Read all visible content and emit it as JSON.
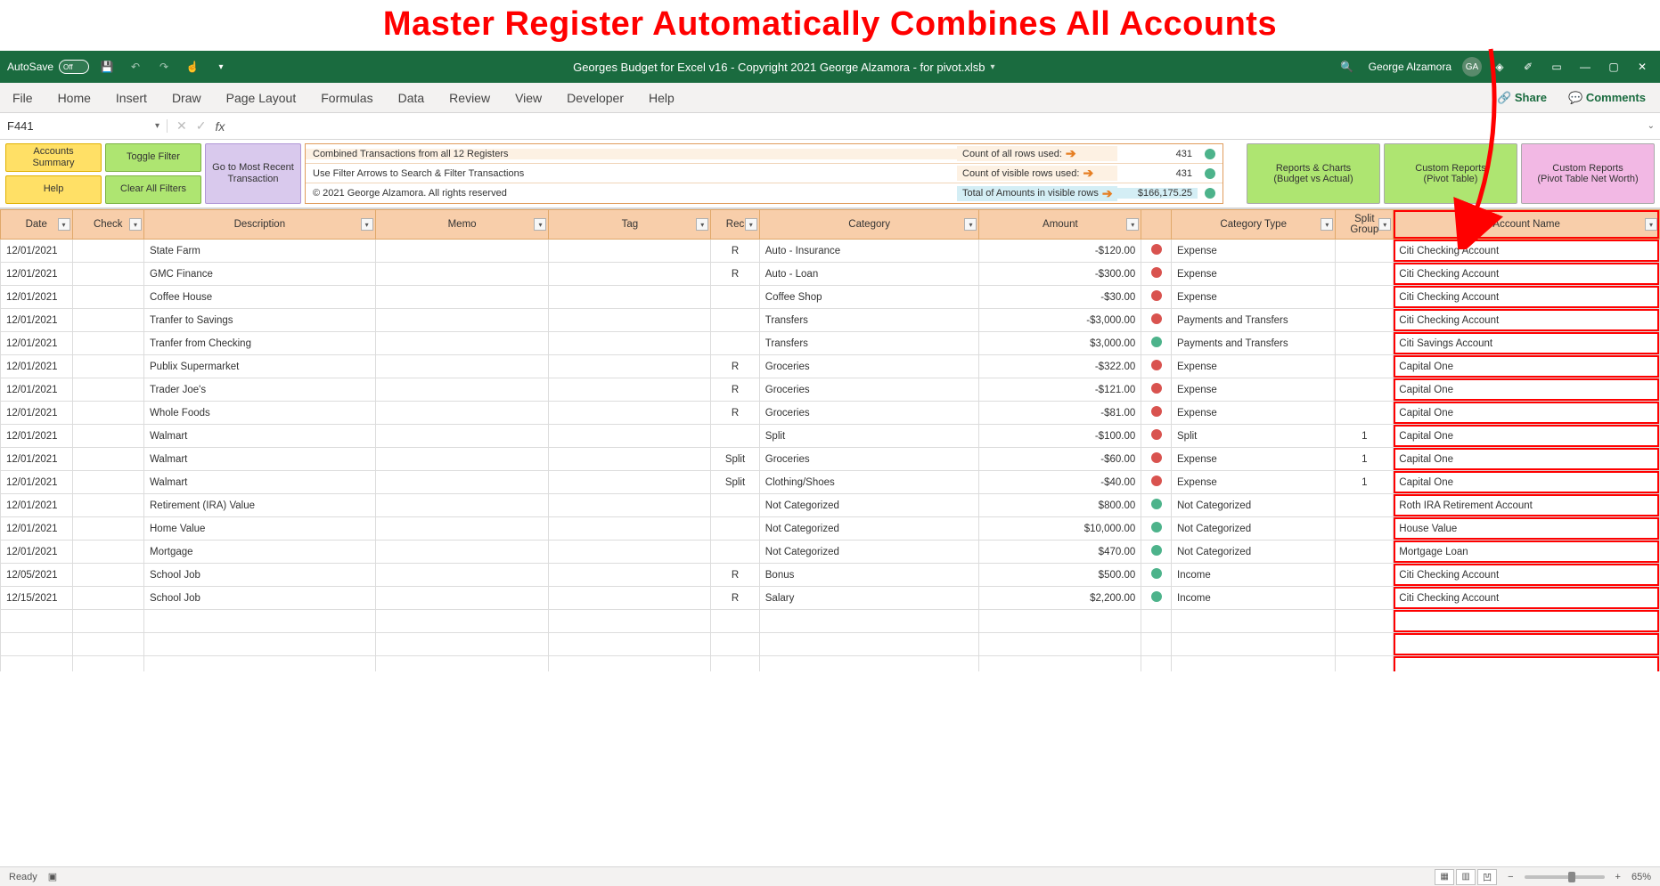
{
  "annotation_title": "Master Register Automatically Combines All Accounts",
  "titlebar": {
    "autosave_label": "AutoSave",
    "autosave_state": "Off",
    "doc_title": "Georges Budget for Excel v16 - Copyright 2021 George Alzamora - for pivot.xlsb",
    "user_name": "George Alzamora",
    "user_initials": "GA"
  },
  "ribbon_tabs": [
    "File",
    "Home",
    "Insert",
    "Draw",
    "Page Layout",
    "Formulas",
    "Data",
    "Review",
    "View",
    "Developer",
    "Help"
  ],
  "ribbon_right": {
    "share": "Share",
    "comments": "Comments"
  },
  "namebox": "F441",
  "formula": "",
  "controls": {
    "accounts_summary": "Accounts Summary",
    "help": "Help",
    "toggle_filter": "Toggle Filter",
    "clear_filters": "Clear All Filters",
    "goto_recent": "Go to Most Recent Transaction",
    "info_rows": [
      {
        "left": "Combined Transactions from all 12 Registers",
        "key": "Count of all rows used:",
        "val": "431"
      },
      {
        "left": "Use Filter Arrows to Search & Filter Transactions",
        "key": "Count of visible rows used:",
        "val": "431"
      },
      {
        "left": "© 2021 George Alzamora. All rights reserved",
        "key": "Total of Amounts in visible rows",
        "val": "$166,175.25"
      }
    ],
    "reports_charts": "Reports & Charts\n(Budget vs Actual)",
    "custom_reports_pivot": "Custom Reports\n(Pivot Table)",
    "custom_reports_networth": "Custom Reports\n(Pivot Table Net Worth)"
  },
  "columns": [
    "Date",
    "Check",
    "Description",
    "Memo",
    "Tag",
    "Rec",
    "Category",
    "Amount",
    "",
    "Category Type",
    "Split Group",
    "Account Name"
  ],
  "rows": [
    {
      "date": "12/01/2021",
      "check": "",
      "desc": "State Farm",
      "memo": "",
      "tag": "",
      "rec": "R",
      "cat": "Auto - Insurance",
      "amt": "-$120.00",
      "dot": "red",
      "ctype": "Expense",
      "split": "",
      "acct": "Citi Checking Account"
    },
    {
      "date": "12/01/2021",
      "check": "",
      "desc": "GMC Finance",
      "memo": "",
      "tag": "",
      "rec": "R",
      "cat": "Auto - Loan",
      "amt": "-$300.00",
      "dot": "red",
      "ctype": "Expense",
      "split": "",
      "acct": "Citi Checking Account"
    },
    {
      "date": "12/01/2021",
      "check": "",
      "desc": "Coffee House",
      "memo": "",
      "tag": "",
      "rec": "",
      "cat": "Coffee Shop",
      "amt": "-$30.00",
      "dot": "red",
      "ctype": "Expense",
      "split": "",
      "acct": "Citi Checking Account"
    },
    {
      "date": "12/01/2021",
      "check": "",
      "desc": "Tranfer to Savings",
      "memo": "",
      "tag": "",
      "rec": "",
      "cat": "Transfers",
      "amt": "-$3,000.00",
      "dot": "red",
      "ctype": "Payments and Transfers",
      "split": "",
      "acct": "Citi Checking Account"
    },
    {
      "date": "12/01/2021",
      "check": "",
      "desc": "Tranfer from Checking",
      "memo": "",
      "tag": "",
      "rec": "",
      "cat": "Transfers",
      "amt": "$3,000.00",
      "dot": "green",
      "ctype": "Payments and Transfers",
      "split": "",
      "acct": "Citi Savings Account"
    },
    {
      "date": "12/01/2021",
      "check": "",
      "desc": "Publix Supermarket",
      "memo": "",
      "tag": "",
      "rec": "R",
      "cat": "Groceries",
      "amt": "-$322.00",
      "dot": "red",
      "ctype": "Expense",
      "split": "",
      "acct": "Capital One"
    },
    {
      "date": "12/01/2021",
      "check": "",
      "desc": "Trader Joe's",
      "memo": "",
      "tag": "",
      "rec": "R",
      "cat": "Groceries",
      "amt": "-$121.00",
      "dot": "red",
      "ctype": "Expense",
      "split": "",
      "acct": "Capital One"
    },
    {
      "date": "12/01/2021",
      "check": "",
      "desc": "Whole Foods",
      "memo": "",
      "tag": "",
      "rec": "R",
      "cat": "Groceries",
      "amt": "-$81.00",
      "dot": "red",
      "ctype": "Expense",
      "split": "",
      "acct": "Capital One"
    },
    {
      "date": "12/01/2021",
      "check": "",
      "desc": "Walmart",
      "memo": "",
      "tag": "",
      "rec": "",
      "cat": "Split",
      "amt": "-$100.00",
      "dot": "red",
      "ctype": "Split",
      "split": "1",
      "acct": "Capital One"
    },
    {
      "date": "12/01/2021",
      "check": "",
      "desc": "Walmart",
      "memo": "",
      "tag": "",
      "rec": "Split",
      "cat": "Groceries",
      "amt": "-$60.00",
      "dot": "red",
      "ctype": "Expense",
      "split": "1",
      "acct": "Capital One"
    },
    {
      "date": "12/01/2021",
      "check": "",
      "desc": "Walmart",
      "memo": "",
      "tag": "",
      "rec": "Split",
      "cat": "Clothing/Shoes",
      "amt": "-$40.00",
      "dot": "red",
      "ctype": "Expense",
      "split": "1",
      "acct": "Capital One"
    },
    {
      "date": "12/01/2021",
      "check": "",
      "desc": "Retirement (IRA) Value",
      "memo": "",
      "tag": "",
      "rec": "",
      "cat": "Not Categorized",
      "amt": "$800.00",
      "dot": "green",
      "ctype": "Not Categorized",
      "split": "",
      "acct": "Roth IRA Retirement Account"
    },
    {
      "date": "12/01/2021",
      "check": "",
      "desc": "Home Value",
      "memo": "",
      "tag": "",
      "rec": "",
      "cat": "Not Categorized",
      "amt": "$10,000.00",
      "dot": "green",
      "ctype": "Not Categorized",
      "split": "",
      "acct": "House Value"
    },
    {
      "date": "12/01/2021",
      "check": "",
      "desc": "Mortgage",
      "memo": "",
      "tag": "",
      "rec": "",
      "cat": "Not Categorized",
      "amt": "$470.00",
      "dot": "green",
      "ctype": "Not Categorized",
      "split": "",
      "acct": "Mortgage Loan"
    },
    {
      "date": "12/05/2021",
      "check": "",
      "desc": "School Job",
      "memo": "",
      "tag": "",
      "rec": "R",
      "cat": "Bonus",
      "amt": "$500.00",
      "dot": "green",
      "ctype": "Income",
      "split": "",
      "acct": "Citi Checking Account"
    },
    {
      "date": "12/15/2021",
      "check": "",
      "desc": "School Job",
      "memo": "",
      "tag": "",
      "rec": "R",
      "cat": "Salary",
      "amt": "$2,200.00",
      "dot": "green",
      "ctype": "Income",
      "split": "",
      "acct": "Citi Checking Account"
    }
  ],
  "statusbar": {
    "ready": "Ready",
    "zoom": "65%"
  }
}
